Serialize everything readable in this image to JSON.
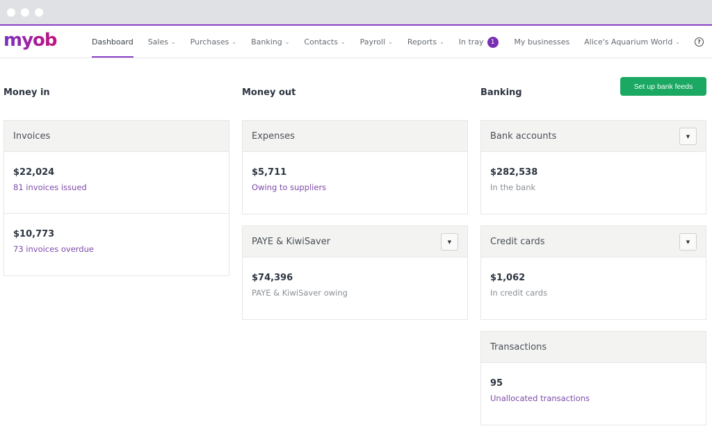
{
  "nav": {
    "logo": "myob",
    "items": [
      {
        "label": "Dashboard",
        "active": true,
        "chevron": false
      },
      {
        "label": "Sales",
        "chevron": true
      },
      {
        "label": "Purchases",
        "chevron": true
      },
      {
        "label": "Banking",
        "chevron": true
      },
      {
        "label": "Contacts",
        "chevron": true
      },
      {
        "label": "Payroll",
        "chevron": true
      },
      {
        "label": "Reports",
        "chevron": true
      },
      {
        "label": "In tray",
        "badge": "1"
      }
    ],
    "my_businesses": "My businesses",
    "business_name": "Alice's Aquarium World",
    "chevron_glyph": "⌄",
    "help_glyph": "?"
  },
  "sections": {
    "money_in": {
      "title": "Money in",
      "invoices": {
        "header": "Invoices",
        "rows": [
          {
            "amount": "$22,024",
            "label": "81 invoices issued"
          },
          {
            "amount": "$10,773",
            "label": "73 invoices overdue"
          }
        ]
      }
    },
    "money_out": {
      "title": "Money out",
      "expenses": {
        "header": "Expenses",
        "amount": "$5,711",
        "label": "Owing to suppliers"
      },
      "paye": {
        "header": "PAYE & KiwiSaver",
        "amount": "$74,396",
        "label": "PAYE & KiwiSaver owing"
      }
    },
    "banking": {
      "title": "Banking",
      "cta": "Set up bank feeds",
      "bank_accounts": {
        "header": "Bank accounts",
        "amount": "$282,538",
        "label": "In the bank"
      },
      "credit_cards": {
        "header": "Credit cards",
        "amount": "$1,062",
        "label": "In credit cards"
      },
      "transactions": {
        "header": "Transactions",
        "amount": "95",
        "label": "Unallocated transactions"
      }
    }
  },
  "dropdown_glyph": "▼",
  "colors": {
    "accent": "#8a3fc6",
    "link": "#7e4aa8",
    "cta": "#1aa862",
    "badge": "#7a2fb3"
  }
}
